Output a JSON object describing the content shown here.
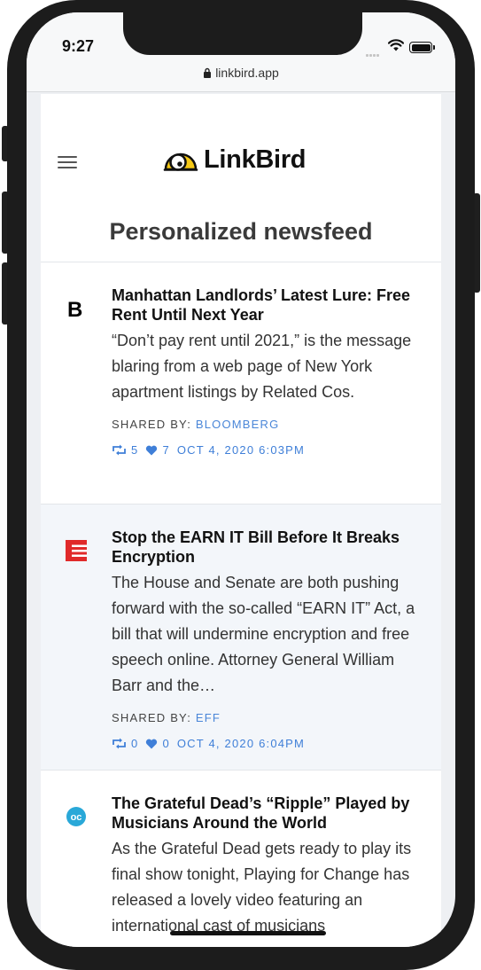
{
  "status_bar": {
    "time": "9:27"
  },
  "browser": {
    "url": "linkbird.app"
  },
  "header": {
    "brand": "LinkBird",
    "title": "Personalized newsfeed"
  },
  "colors": {
    "accent": "#4a86d8",
    "eff_red": "#e02a2a",
    "oc_blue": "#29a8d8"
  },
  "feed": [
    {
      "logo": "bloomberg-logo",
      "title": "Manhattan Landlords’ Latest Lure: Free Rent Until Next Year",
      "summary": "“Don’t pay rent until 2021,” is the message blaring from a web page of New York apartment listings by Related Cos.",
      "shared_by_label": "SHARED BY:",
      "source": "BLOOMBERG",
      "retweets": "5",
      "likes": "7",
      "timestamp": "OCT 4, 2020 6:03PM"
    },
    {
      "logo": "eff-logo",
      "title": "Stop the EARN IT Bill Before It Breaks Encryption",
      "summary": "The House and Senate are both pushing forward with the so-called “EARN IT” Act, a bill that will undermine encryption and free speech online. Attorney General William Barr and the…",
      "shared_by_label": "SHARED BY:",
      "source": "EFF",
      "retweets": "0",
      "likes": "0",
      "timestamp": "OCT 4, 2020 6:04PM"
    },
    {
      "logo": "openculture-logo",
      "title": "The Grateful Dead’s “Ripple” Played by Musicians Around the World",
      "summary": "As the Grateful Dead gets ready to play its final show tonight, Playing for Change has released a lovely video featuring an international cast of musicians"
    }
  ]
}
